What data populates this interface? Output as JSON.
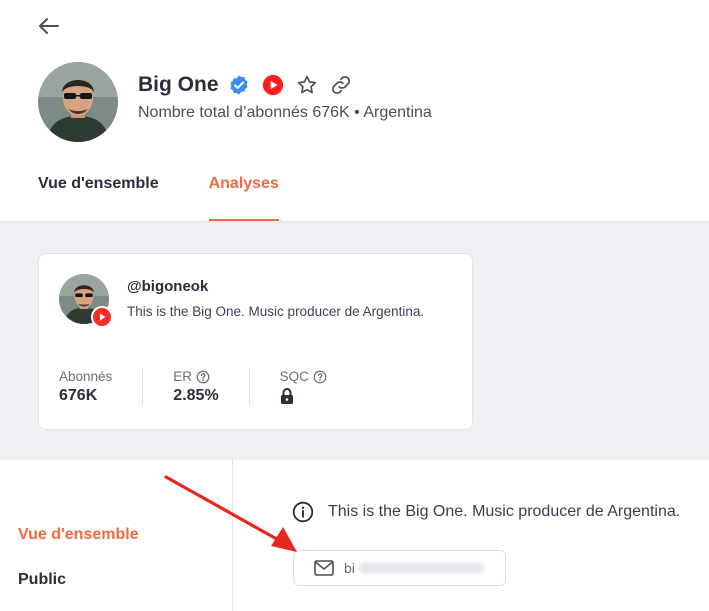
{
  "header": {
    "channel_name": "Big One",
    "subscribers_text": "Nombre total d’abonnés 676K",
    "separator": "•",
    "country": "Argentina"
  },
  "tabs": [
    {
      "label": "Vue d'ensemble",
      "active": false
    },
    {
      "label": "Analyses",
      "active": true
    }
  ],
  "card": {
    "handle": "@bigoneok",
    "description": "This is the Big One. Music producer de Argentina.",
    "stats": [
      {
        "label": "Abonnés",
        "value": "676K"
      },
      {
        "label": "ER",
        "value": "2.85%"
      },
      {
        "label": "SQC",
        "value": ""
      }
    ]
  },
  "sidebar": {
    "items": [
      {
        "label": "Vue d'ensemble",
        "active": true
      },
      {
        "label": "Public",
        "active": false
      }
    ]
  },
  "about": {
    "description": "This is the Big One. Music producer de Argentina.",
    "email_prefix": "bi"
  },
  "colors": {
    "accent": "#f2683f",
    "verified": "#3b8ef0",
    "youtube": "#ff2b2b",
    "annotation_arrow": "#e8261f"
  },
  "icons": [
    "back-arrow-icon",
    "verified-icon",
    "youtube-icon",
    "star-icon",
    "link-icon",
    "help-icon",
    "lock-icon",
    "info-icon",
    "mail-icon"
  ]
}
